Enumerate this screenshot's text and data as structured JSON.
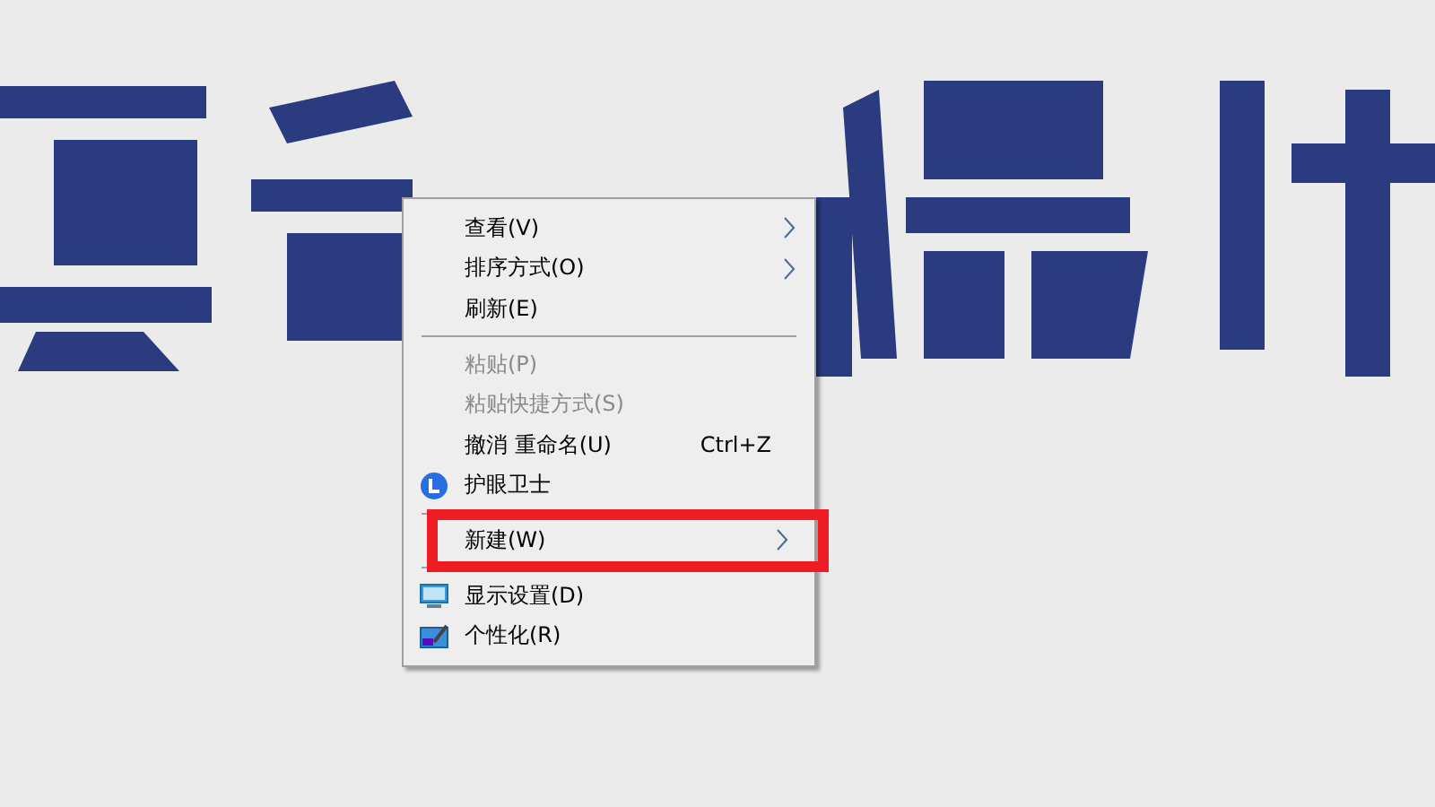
{
  "context_menu": {
    "items": [
      {
        "kind": "item",
        "label": "查看(V)",
        "disabled": false,
        "submenu": true
      },
      {
        "kind": "item",
        "label": "排序方式(O)",
        "disabled": false,
        "submenu": true
      },
      {
        "kind": "item",
        "label": "刷新(E)",
        "disabled": false,
        "submenu": false
      },
      {
        "kind": "separator"
      },
      {
        "kind": "item",
        "label": "粘贴(P)",
        "disabled": true,
        "submenu": false
      },
      {
        "kind": "item",
        "label": "粘贴快捷方式(S)",
        "disabled": true,
        "submenu": false
      },
      {
        "kind": "item",
        "label": "撤消 重命名(U)",
        "shortcut": "Ctrl+Z",
        "disabled": false,
        "submenu": false
      },
      {
        "kind": "item",
        "label": "护眼卫士",
        "disabled": false,
        "submenu": false
      },
      {
        "kind": "separator"
      },
      {
        "kind": "item",
        "label": "新建(W)",
        "disabled": false,
        "submenu": true,
        "annotated": true
      },
      {
        "kind": "separator"
      },
      {
        "kind": "item",
        "label": "显示设置(D)",
        "disabled": false,
        "submenu": false
      },
      {
        "kind": "item",
        "label": "个性化(R)",
        "disabled": false,
        "submenu": false
      }
    ]
  }
}
